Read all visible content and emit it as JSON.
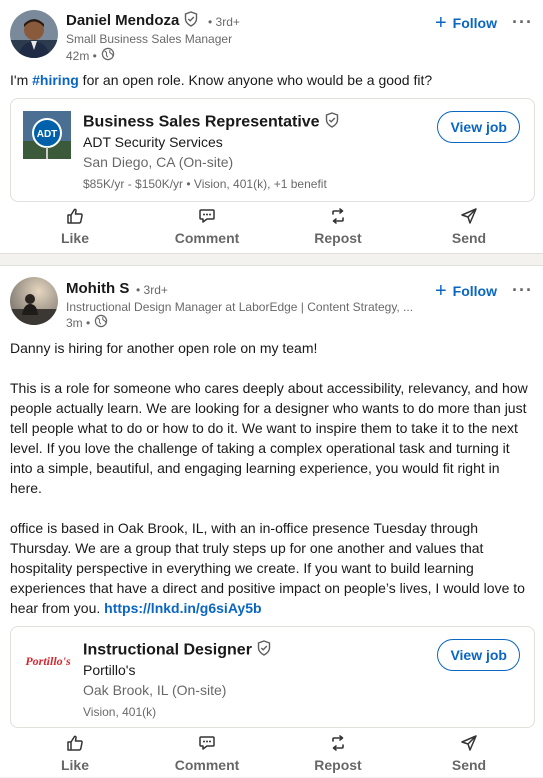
{
  "posts": [
    {
      "author": "Daniel Mendoza",
      "degree": "• 3rd+",
      "headline": "Small Business Sales Manager",
      "time": "42m •",
      "text_before": "I'm ",
      "hashtag": "#hiring",
      "text_after": " for an open role. Know anyone who would be a good fit?",
      "follow_label": "Follow",
      "more_label": "···",
      "job": {
        "title": "Business Sales Representative",
        "company": "ADT Security Services",
        "location": "San Diego, CA (On-site)",
        "benefits": "$85K/yr - $150K/yr • Vision, 401(k), +1 benefit",
        "logo_text": "ADT",
        "button": "View job"
      },
      "actions": {
        "like": "Like",
        "comment": "Comment",
        "repost": "Repost",
        "send": "Send"
      }
    },
    {
      "author": "Mohith S",
      "degree": "• 3rd+",
      "headline": "Instructional Design Manager at LaborEdge | Content Strategy, ...",
      "time": "3m •",
      "paragraphs": [
        "Danny is hiring for another open role on my team!",
        "This is a role for someone who cares deeply about accessibility, relevancy, and how people actually learn. We are looking for a designer who wants to do more than just tell people what to do or how to do it. We want to inspire them to take it to the next level. If you love the challenge of taking a complex operational task and turning it into a simple, beautiful, and engaging learning experience, you would fit right in here.",
        "office is based in Oak Brook, IL, with an in-office presence Tuesday through Thursday. We are a group that truly steps up for one another and values that hospitality perspective in everything we create. If you want to build learning experiences that have a direct and positive impact on people’s lives, I would love to hear from you. "
      ],
      "link": "https://lnkd.in/g6siAy5b",
      "follow_label": "Follow",
      "more_label": "···",
      "job": {
        "title": "Instructional Designer",
        "company": "Portillo's",
        "location": "Oak Brook, IL (On-site)",
        "benefits": "Vision, 401(k)",
        "logo_text": "Portillo's",
        "button": "View job"
      },
      "actions": {
        "like": "Like",
        "comment": "Comment",
        "repost": "Repost",
        "send": "Send"
      }
    }
  ],
  "colors": {
    "accent": "#0a66c2",
    "adt_blue": "#0061aa",
    "portillos_red": "#d7282f"
  },
  "icons": [
    "verified-icon",
    "globe-icon",
    "like-icon",
    "comment-icon",
    "repost-icon",
    "send-icon"
  ]
}
